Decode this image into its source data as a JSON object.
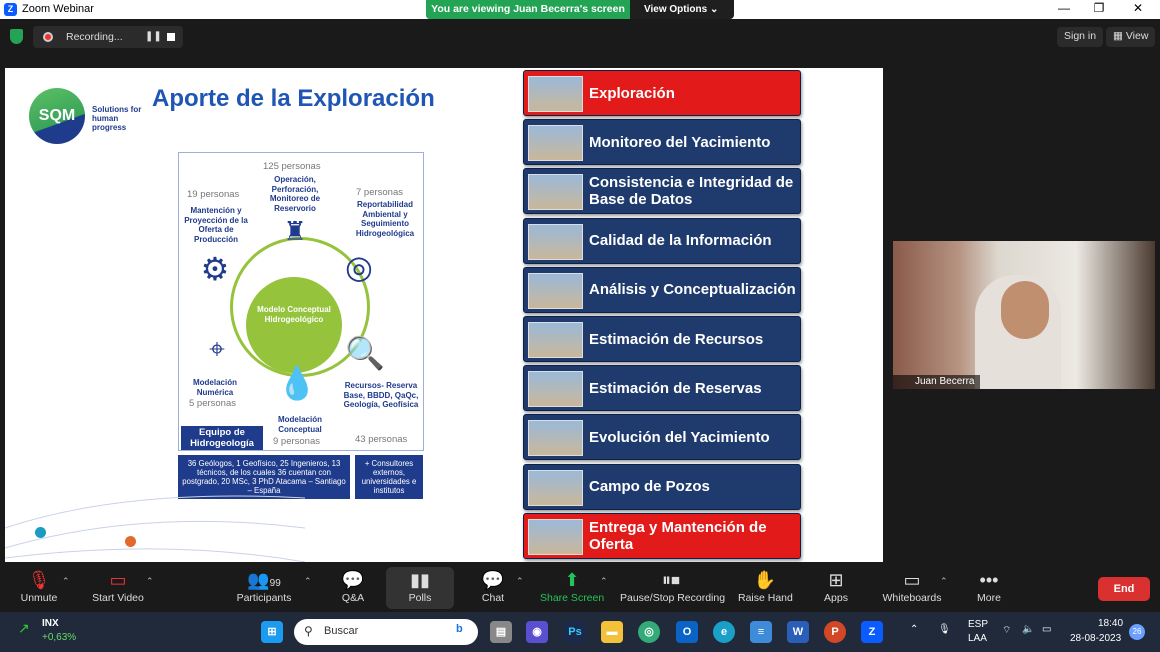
{
  "window": {
    "title": "Zoom Webinar",
    "min": "—",
    "max": "❐",
    "close": "✕",
    "banner": "You are viewing Juan Becerra's screen",
    "view_options": "View Options"
  },
  "topbar": {
    "recording": "Recording...",
    "sign_in": "Sign in",
    "view": "View"
  },
  "slide": {
    "logo": "SQM",
    "tagline": "Solutions for human progress",
    "title": "Aporte de la Exploración",
    "circle": {
      "center": "Modelo Conceptual Hidrogeológico",
      "top": {
        "count": "125 personas",
        "desc": "Operación, Perforación, Monitoreo de Reservorio"
      },
      "top_left": {
        "count": "19 personas",
        "desc": "Mantención y Proyección de la Oferta de Producción"
      },
      "top_right": {
        "count": "7 personas",
        "desc": "Reportabilidad Ambiental y Seguimiento Hidrogeológica"
      },
      "left": {
        "desc": "Modelación Numérica",
        "count": "5 personas"
      },
      "bottom": {
        "desc": "Modelación Conceptual",
        "count": "9 personas"
      },
      "right": {
        "desc": "Recursos- Reserva Base, BBDD, QaQc, Geología, Geofísica",
        "count": "43 personas"
      },
      "team": "Equipo de Hidrogeología"
    },
    "info_left": "36 Geólogos, 1 Geofísico, 25 Ingenieros, 13 técnicos, de los cuales 36 cuentan con postgrado, 20 MSc, 3 PhD Atacama – Santiago – España",
    "info_right": "+ Consultores externos, universidades e institutos",
    "menu": [
      {
        "label": "Exploración",
        "color": "#e21a1a"
      },
      {
        "label": "Monitoreo del Yacimiento",
        "color": "#1f3b6e"
      },
      {
        "label": "Consistencia e Integridad de Base de Datos",
        "color": "#1f3b6e"
      },
      {
        "label": "Calidad de la Información",
        "color": "#1f3b6e"
      },
      {
        "label": "Análisis y Conceptualización",
        "color": "#1f3b6e"
      },
      {
        "label": "Estimación de Recursos",
        "color": "#1f3b6e"
      },
      {
        "label": "Estimación de Reservas",
        "color": "#1f3b6e"
      },
      {
        "label": "Evolución del Yacimiento",
        "color": "#1f3b6e"
      },
      {
        "label": "Campo de Pozos",
        "color": "#1f3b6e"
      },
      {
        "label": "Entrega y Mantención de Oferta",
        "color": "#e21a1a"
      }
    ]
  },
  "camera": {
    "name": "Juan Becerra"
  },
  "toolbar": {
    "unmute": "Unmute",
    "start_video": "Start Video",
    "participants": "Participants",
    "participants_count": "99",
    "qa": "Q&A",
    "polls": "Polls",
    "chat": "Chat",
    "share": "Share Screen",
    "record": "Pause/Stop Recording",
    "raise": "Raise Hand",
    "apps": "Apps",
    "whiteboards": "Whiteboards",
    "more": "More",
    "end": "End"
  },
  "taskbar": {
    "ticker": "INX",
    "change": "+0,63%",
    "search": "Buscar",
    "lang1": "ESP",
    "lang2": "LAA",
    "time": "18:40",
    "date": "28-08-2023",
    "badge": "26"
  }
}
